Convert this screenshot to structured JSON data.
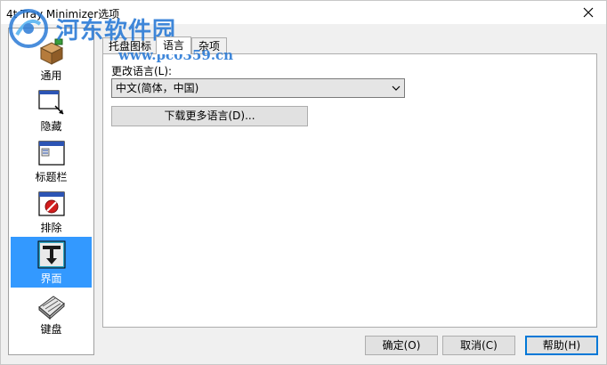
{
  "window": {
    "title": "4t Tray Minimizer选项"
  },
  "watermark": {
    "name": "河东软件园",
    "url": "www.pc0359.cn"
  },
  "sidebar": {
    "items": [
      {
        "label": "通用",
        "icon": "package-icon"
      },
      {
        "label": "隐藏",
        "icon": "window-hide-icon"
      },
      {
        "label": "标题栏",
        "icon": "titlebar-window-icon"
      },
      {
        "label": "排除",
        "icon": "exclude-icon"
      },
      {
        "label": "界面",
        "icon": "interface-icon"
      },
      {
        "label": "键盘",
        "icon": "keyboard-icon"
      }
    ],
    "selected": "界面"
  },
  "tabs": [
    {
      "label": "托盘图标"
    },
    {
      "label": "语言"
    },
    {
      "label": "杂项"
    }
  ],
  "active_tab": "语言",
  "language": {
    "label": "更改语言(L):",
    "selected": "中文(简体，中国)",
    "download_button": "下载更多语言(D)..."
  },
  "buttons": {
    "ok": "确定(O)",
    "cancel": "取消(C)",
    "help": "帮助(H)"
  },
  "colors": {
    "selection": "#3399ff",
    "default_button_border": "#0078d7",
    "watermark": "#2b7bd6"
  }
}
